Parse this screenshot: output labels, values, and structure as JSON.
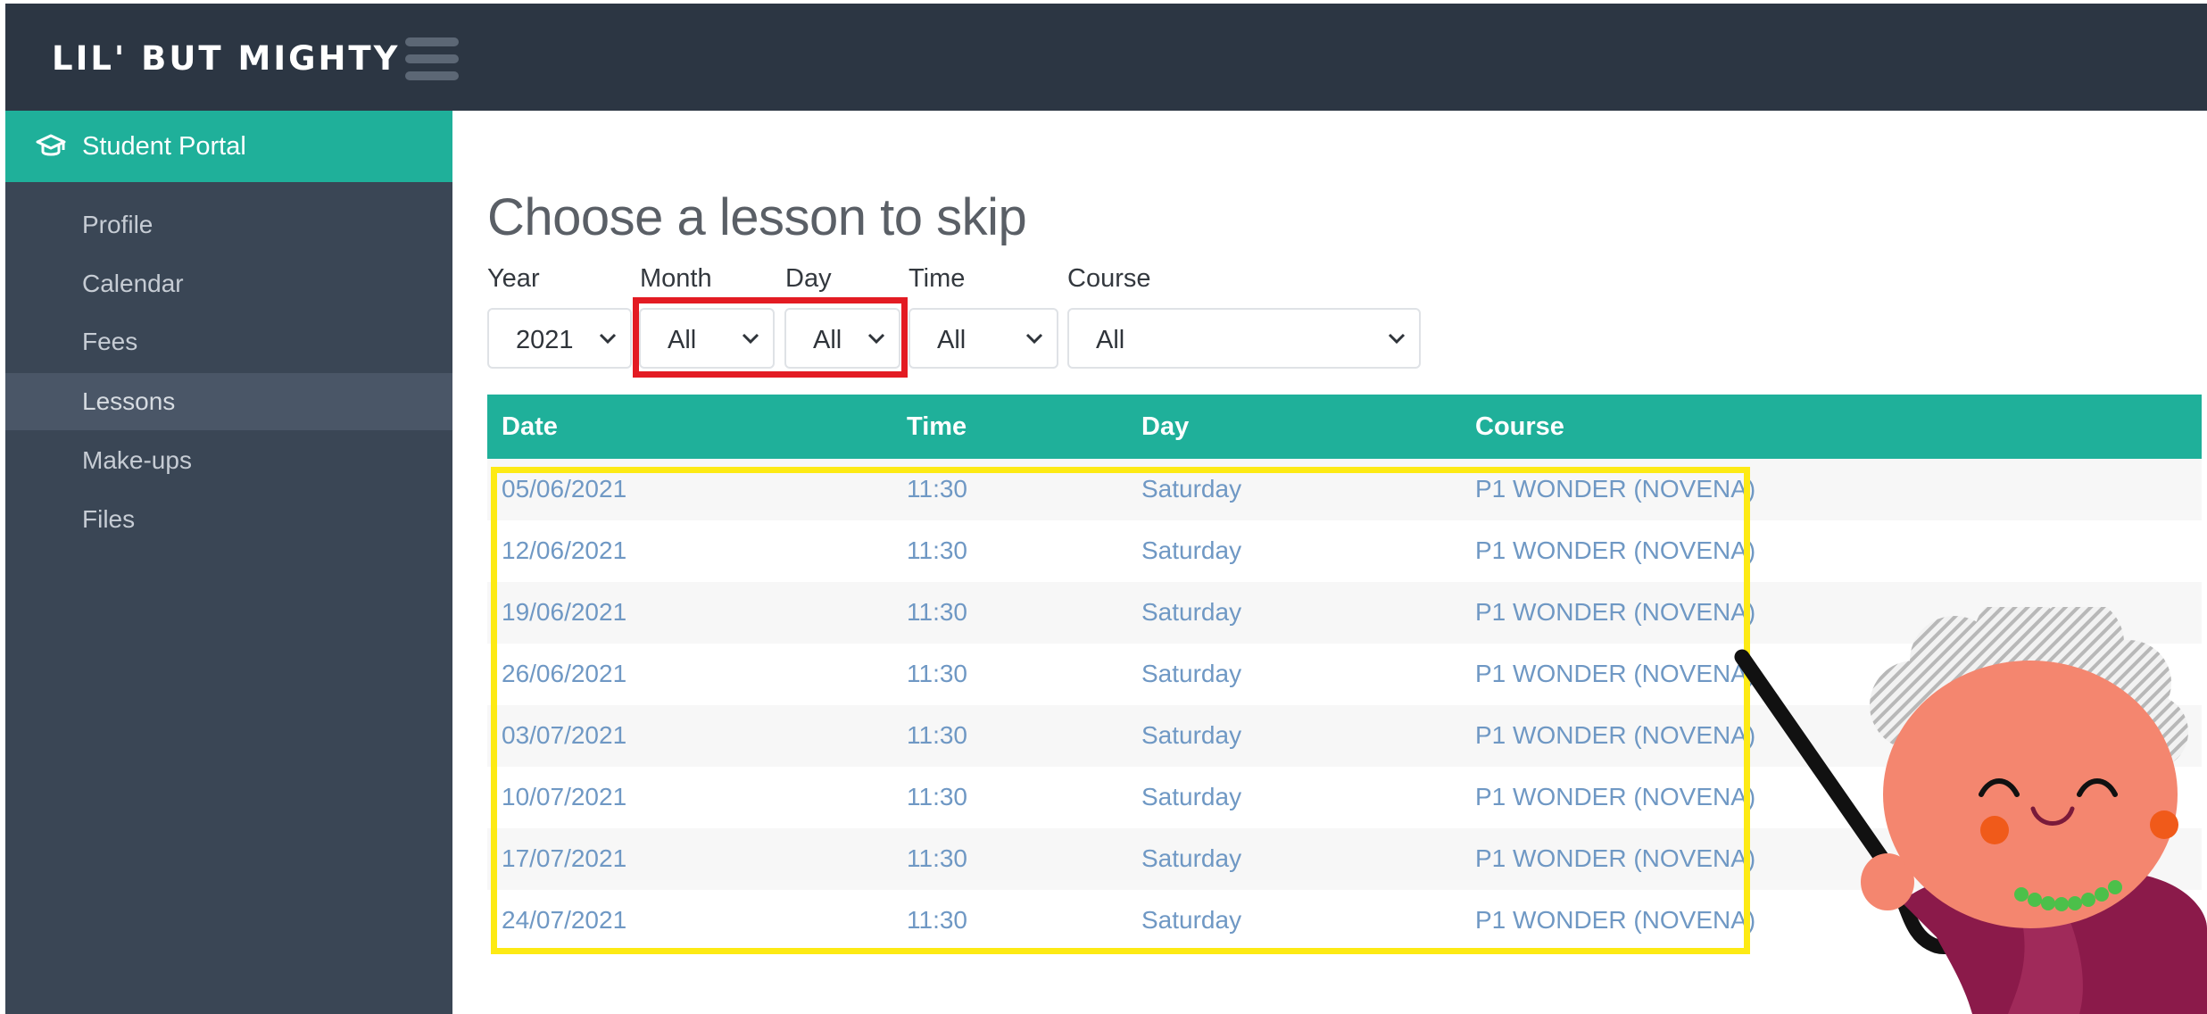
{
  "header": {
    "logo_text": "LIL' BUT MIGHTY",
    "menu_icon": "hamburger-icon"
  },
  "sidebar": {
    "portal_label": "Student Portal",
    "portal_icon": "graduation-cap-icon",
    "items": [
      {
        "label": "Profile"
      },
      {
        "label": "Calendar"
      },
      {
        "label": "Fees"
      },
      {
        "label": "Lessons",
        "active": true
      },
      {
        "label": "Make-ups"
      },
      {
        "label": "Files"
      }
    ]
  },
  "main": {
    "title": "Choose a lesson to skip",
    "filters": [
      {
        "label": "Year",
        "value": "2021"
      },
      {
        "label": "Month",
        "value": "All"
      },
      {
        "label": "Day",
        "value": "All"
      },
      {
        "label": "Time",
        "value": "All"
      },
      {
        "label": "Course",
        "value": "All"
      }
    ]
  },
  "table": {
    "columns": [
      "Date",
      "Time",
      "Day",
      "Course"
    ],
    "rows": [
      [
        "05/06/2021",
        "11:30",
        "Saturday",
        "P1 WONDER (NOVENA)"
      ],
      [
        "12/06/2021",
        "11:30",
        "Saturday",
        "P1 WONDER (NOVENA)"
      ],
      [
        "19/06/2021",
        "11:30",
        "Saturday",
        "P1 WONDER (NOVENA)"
      ],
      [
        "26/06/2021",
        "11:30",
        "Saturday",
        "P1 WONDER (NOVENA)"
      ],
      [
        "03/07/2021",
        "11:30",
        "Saturday",
        "P1 WONDER (NOVENA)"
      ],
      [
        "10/07/2021",
        "11:30",
        "Saturday",
        "P1 WONDER (NOVENA)"
      ],
      [
        "17/07/2021",
        "11:30",
        "Saturday",
        "P1 WONDER (NOVENA)"
      ],
      [
        "24/07/2021",
        "11:30",
        "Saturday",
        "P1 WONDER (NOVENA)"
      ]
    ]
  },
  "colors": {
    "topbar": "#2c3643",
    "sidebar": "#3a4655",
    "accent": "#1fb09a",
    "link": "#6f98c4",
    "highlight_red": "#e31b23",
    "highlight_yellow": "#fdea14"
  }
}
